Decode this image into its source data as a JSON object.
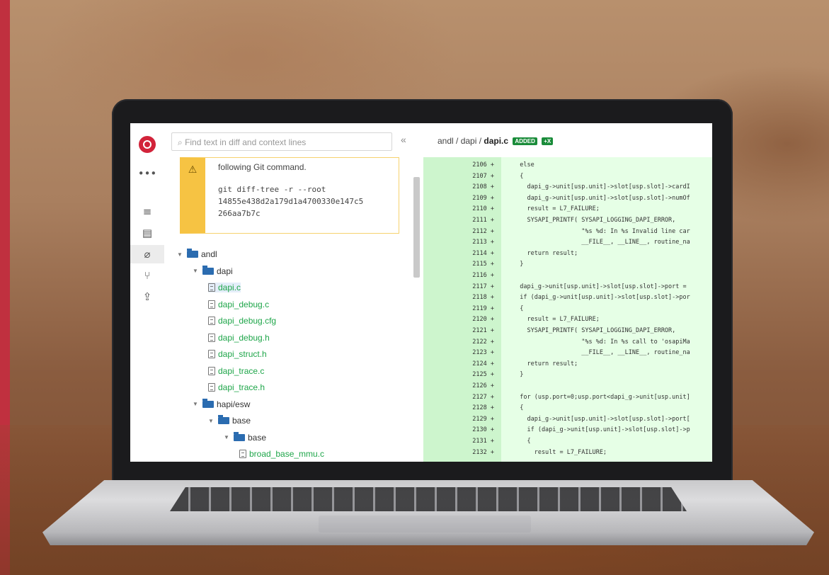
{
  "app": {
    "search_placeholder": "Find text in diff and context lines",
    "rail_icons": [
      {
        "name": "more-icon",
        "glyph": "•••"
      },
      {
        "name": "list-icon",
        "glyph": "≡"
      },
      {
        "name": "document-icon",
        "glyph": "▤"
      },
      {
        "name": "commit-icon",
        "glyph": "⌀"
      },
      {
        "name": "branch-icon",
        "glyph": "⑂"
      },
      {
        "name": "share-icon",
        "glyph": "⇪"
      }
    ]
  },
  "warning": {
    "text": "following Git command.",
    "code_lines": [
      "git diff-tree -r --root",
      "14855e438d2a179d1a4700330e147c5",
      "266aa7b7c"
    ]
  },
  "tree": [
    {
      "label": "andl",
      "type": "dir",
      "depth": 0
    },
    {
      "label": "dapi",
      "type": "dir",
      "depth": 1
    },
    {
      "label": "dapi.c",
      "type": "file",
      "depth": 2,
      "selected": true
    },
    {
      "label": "dapi_debug.c",
      "type": "file",
      "depth": 2
    },
    {
      "label": "dapi_debug.cfg",
      "type": "file",
      "depth": 2
    },
    {
      "label": "dapi_debug.h",
      "type": "file",
      "depth": 2
    },
    {
      "label": "dapi_struct.h",
      "type": "file",
      "depth": 2
    },
    {
      "label": "dapi_trace.c",
      "type": "file",
      "depth": 2
    },
    {
      "label": "dapi_trace.h",
      "type": "file",
      "depth": 2
    },
    {
      "label": "hapi/esw",
      "type": "dir",
      "depth": 1
    },
    {
      "label": "base",
      "type": "dir",
      "depth": 2
    },
    {
      "label": "base",
      "type": "dir",
      "depth": 3
    },
    {
      "label": "broad_base_mmu.c",
      "type": "file",
      "depth": 4
    }
  ],
  "diff": {
    "path_prefix": "andl / dapi / ",
    "filename": "dapi.c",
    "badge_added": "ADDED",
    "badge_x": "+X",
    "lines": [
      {
        "n": "2106 +",
        "code": "  else"
      },
      {
        "n": "2107 +",
        "code": "  {"
      },
      {
        "n": "2108 +",
        "code": "    dapi_g->unit[usp.unit]->slot[usp.slot]->cardI"
      },
      {
        "n": "2109 +",
        "code": "    dapi_g->unit[usp.unit]->slot[usp.slot]->numOf"
      },
      {
        "n": "2110 +",
        "code": "    result = L7_FAILURE;"
      },
      {
        "n": "2111 +",
        "code": "    SYSAPI_PRINTF( SYSAPI_LOGGING_DAPI_ERROR,"
      },
      {
        "n": "2112 +",
        "code": "                   \"%s %d: In %s Invalid line car"
      },
      {
        "n": "2113 +",
        "code": "                   __FILE__, __LINE__, routine_na"
      },
      {
        "n": "2114 +",
        "code": "    return result;"
      },
      {
        "n": "2115 +",
        "code": "  }"
      },
      {
        "n": "2116 +",
        "code": ""
      },
      {
        "n": "2117 +",
        "code": "  dapi_g->unit[usp.unit]->slot[usp.slot]->port ="
      },
      {
        "n": "2118 +",
        "code": "  if (dapi_g->unit[usp.unit]->slot[usp.slot]->por"
      },
      {
        "n": "2119 +",
        "code": "  {"
      },
      {
        "n": "2120 +",
        "code": "    result = L7_FAILURE;"
      },
      {
        "n": "2121 +",
        "code": "    SYSAPI_PRINTF( SYSAPI_LOGGING_DAPI_ERROR,"
      },
      {
        "n": "2122 +",
        "code": "                   \"%s %d: In %s call to 'osapiMa"
      },
      {
        "n": "2123 +",
        "code": "                   __FILE__, __LINE__, routine_na"
      },
      {
        "n": "2124 +",
        "code": "    return result;"
      },
      {
        "n": "2125 +",
        "code": "  }"
      },
      {
        "n": "2126 +",
        "code": ""
      },
      {
        "n": "2127 +",
        "code": "  for (usp.port=0;usp.port<dapi_g->unit[usp.unit]"
      },
      {
        "n": "2128 +",
        "code": "  {"
      },
      {
        "n": "2129 +",
        "code": "    dapi_g->unit[usp.unit]->slot[usp.slot]->port["
      },
      {
        "n": "2130 +",
        "code": "    if (dapi_g->unit[usp.unit]->slot[usp.slot]->p"
      },
      {
        "n": "2131 +",
        "code": "    {"
      },
      {
        "n": "2132 +",
        "code": "      result = L7_FAILURE;"
      }
    ]
  }
}
